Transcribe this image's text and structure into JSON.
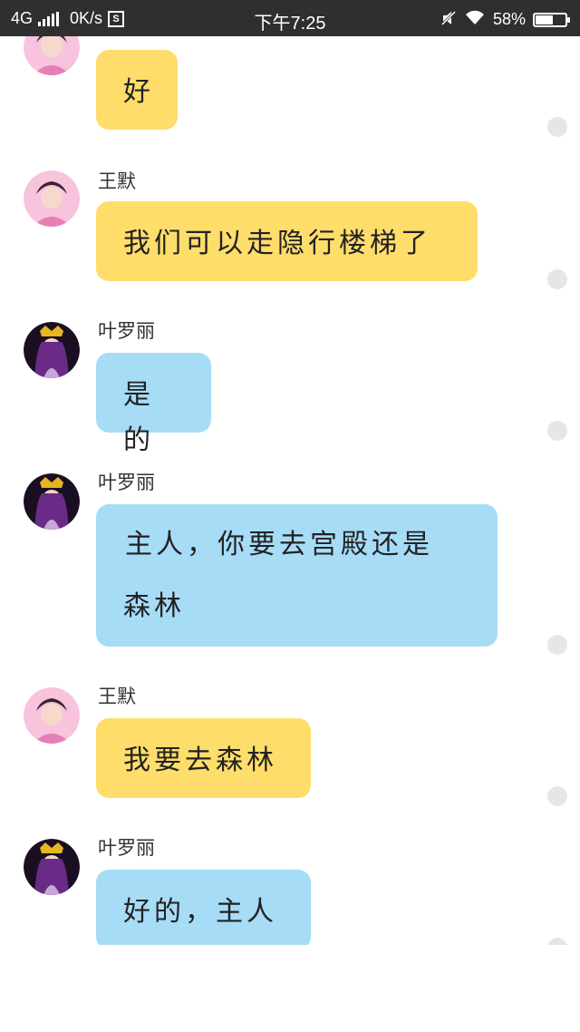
{
  "status_bar": {
    "network": "4G",
    "speed": "0K/s",
    "time": "下午7:25",
    "battery": "58%",
    "battery_level": 0.58,
    "icons": [
      "signal-icon",
      "sd-card-icon",
      "mute-icon",
      "wifi-icon",
      "battery-icon"
    ]
  },
  "messages": [
    {
      "sender": "",
      "text": "好",
      "color": "#ffdd6b",
      "avatar": "wang-mo"
    },
    {
      "sender": "王默",
      "text": "我们可以走隐行楼梯了",
      "color": "#ffdd6b",
      "avatar": "wang-mo"
    },
    {
      "sender": "叶罗丽",
      "text": "是的",
      "color": "#a7dcf7",
      "avatar": "ye-luoli"
    },
    {
      "sender": "叶罗丽",
      "text_line1": "主人，你要去宫殿还是",
      "text_line2": "森林",
      "color": "#a7dcf7",
      "avatar": "ye-luoli"
    },
    {
      "sender": "王默",
      "text": "我要去森林",
      "color": "#ffdd6b",
      "avatar": "wang-mo"
    },
    {
      "sender": "叶罗丽",
      "text": "好的，主人",
      "color": "#a7dcf7",
      "avatar": "ye-luoli"
    }
  ]
}
